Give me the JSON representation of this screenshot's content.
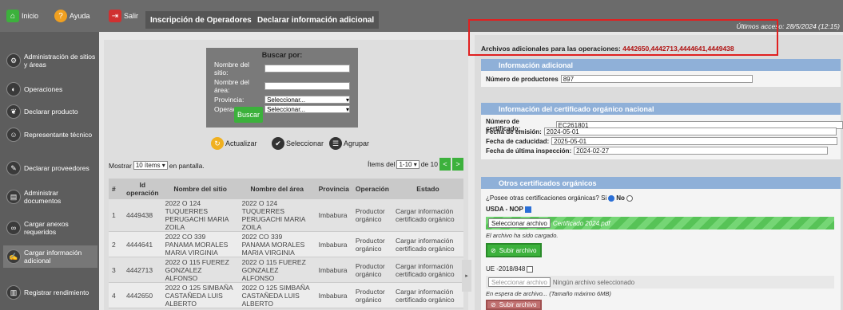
{
  "topbar": {
    "inicio": "Inicio",
    "ayuda": "Ayuda",
    "salir": "Salir",
    "tab1": "Inscripción de Operadores",
    "tab2": "Declarar información adicional",
    "last_access": "Últimos acceso: 28/5/2024 (12:15)"
  },
  "sidebar": {
    "items": [
      {
        "label": "Administración de sitios y áreas"
      },
      {
        "label": "Operaciones"
      },
      {
        "label": "Declarar producto"
      },
      {
        "label": "Representante técnico"
      },
      {
        "label": "Declarar proveedores"
      },
      {
        "label": "Administrar documentos"
      },
      {
        "label": "Cargar anexos requeridos"
      },
      {
        "label": "Cargar información adicional"
      },
      {
        "label": "Registrar rendimiento"
      }
    ]
  },
  "search": {
    "title": "Buscar por:",
    "site_label": "Nombre del sitio:",
    "area_label": "Nombre del área:",
    "province_label": "Provincia:",
    "operation_label": "Operación:",
    "province_value": "Seleccionar...",
    "operation_value": "Seleccionar...",
    "button": "Buscar"
  },
  "actions": {
    "refresh": "Actualizar",
    "select": "Seleccionar",
    "group": "Agrupar"
  },
  "listing": {
    "show_prefix": "Mostrar",
    "show_value": "10 ítems",
    "show_suffix": "en pantalla.",
    "items_prefix": "Ítems del",
    "items_range": "1-10",
    "items_of": "de 10",
    "prev": "<",
    "next": ">"
  },
  "table": {
    "headers": [
      "#",
      "Id operación",
      "Nombre del sitio",
      "Nombre del área",
      "Provincia",
      "Operación",
      "Estado"
    ],
    "rows": [
      [
        "1",
        "4449438",
        "2022 O 124 TUQUERRES PERUGACHI MARIA ZOILA",
        "2022 O 124 TUQUERRES PERUGACHI MARIA ZOILA",
        "Imbabura",
        "Productor orgánico",
        "Cargar información certificado orgánico"
      ],
      [
        "2",
        "4444641",
        "2022 CO 339 PANAMA MORALES MARIA VIRGINIA",
        "2022 CO 339 PANAMA MORALES MARIA VIRGINIA",
        "Imbabura",
        "Productor orgánico",
        "Cargar información certificado orgánico"
      ],
      [
        "3",
        "4442713",
        "2022 O 115 FUEREZ GONZALEZ ALFONSO",
        "2022 O 115 FUEREZ GONZALEZ ALFONSO",
        "Imbabura",
        "Productor orgánico",
        "Cargar información certificado orgánico"
      ],
      [
        "4",
        "4442650",
        "2022 O 125 SIMBAÑA CASTAÑEDA LUIS ALBERTO",
        "2022 O 125 SIMBAÑA CASTAÑEDA LUIS ALBERTO",
        "Imbabura",
        "Productor orgánico",
        "Cargar información certificado orgánico"
      ]
    ]
  },
  "right": {
    "title_prefix": "Archivos adicionales para las operaciones:",
    "title_ids": "4442650,4442713,4444641,4449438",
    "info_header": "Información adicional",
    "producers_label": "Número de productores",
    "producers_value": "897",
    "cert_header": "Información del certificado orgánico nacional",
    "cert_number_label": "Número de certificado:",
    "cert_number_value": "EC261801",
    "issue_label": "Fecha de emisión:",
    "issue_value": "2024-05-01",
    "expiry_label": "Fecha de caducidad:",
    "expiry_value": "2025-05-01",
    "inspection_label": "Fecha de última inspección:",
    "inspection_value": "2024-02-27",
    "other_header": "Otros certificados orgánicos",
    "other_question": "¿Posee otras certificaciones orgánicas? Si",
    "no_label": "No",
    "usda_label": "USDA - NOP",
    "select_file": "Seleccionar archivo",
    "usda_file": "Certificado 2024.pdf",
    "loaded_msg": "El archivo ha sido cargado.",
    "upload_btn": "Subir archivo",
    "ue_label": "UE -2018/848",
    "no_file": "Ningún archivo seleccionado",
    "waiting_msg": "En espera de archivo... (Tamaño máximo 6MB)",
    "upload_btn2": "Subir archivo"
  }
}
